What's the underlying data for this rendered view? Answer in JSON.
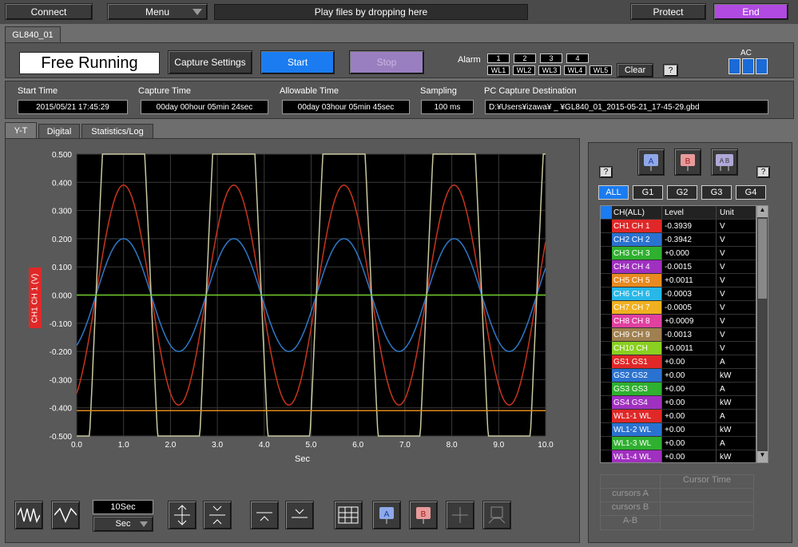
{
  "topbar": {
    "connect": "Connect",
    "menu": "Menu",
    "drop_hint": "Play files by dropping here",
    "protect": "Protect",
    "end": "End"
  },
  "device_tab": "GL840_01",
  "status": {
    "mode": "Free Running",
    "capture_settings": "Capture Settings",
    "start": "Start",
    "stop": "Stop"
  },
  "alarm": {
    "label": "Alarm",
    "numbers": [
      "1",
      "2",
      "3",
      "4"
    ],
    "wl": [
      "WL1",
      "WL2",
      "WL3",
      "WL4",
      "WL5"
    ],
    "clear": "Clear",
    "help": "?",
    "ac": "AC"
  },
  "info": {
    "start_time_label": "Start Time",
    "start_time": "2015/05/21 17:45:29",
    "capture_time_label": "Capture Time",
    "capture_time": "00day 00hour 05min 24sec",
    "allowable_time_label": "Allowable Time",
    "allowable_time": "00day 03hour 05min 45sec",
    "sampling_label": "Sampling",
    "sampling": "100 ms",
    "dest_label": "PC Capture Destination",
    "dest": "D:¥Users¥izawa¥ _ ¥GL840_01_2015-05-21_17-45-29.gbd"
  },
  "view_tabs": [
    "Y-T",
    "Digital",
    "Statistics/Log"
  ],
  "chart_data": {
    "type": "line",
    "ylabel": "CH1 CH 1 (V)",
    "xlabel": "Sec",
    "ylim": [
      -0.5,
      0.5
    ],
    "xlim": [
      0,
      10
    ],
    "yticks": [
      "0.500",
      "0.400",
      "0.300",
      "0.200",
      "0.100",
      "0.000",
      "-0.100",
      "-0.200",
      "-0.300",
      "-0.400",
      "-0.500"
    ],
    "xticks": [
      "0.0",
      "1.0",
      "2.0",
      "3.0",
      "4.0",
      "5.0",
      "6.0",
      "7.0",
      "8.0",
      "9.0",
      "10.0"
    ],
    "series": [
      {
        "color": "#c8341e",
        "amplitude": 0.39,
        "period": 2.35,
        "phase_peak_x": 1.0
      },
      {
        "color": "#2f78c8",
        "amplitude": 0.2,
        "period": 2.35,
        "phase_peak_x": 1.0
      },
      {
        "color": "#c8c8a0",
        "amplitude": 1.4,
        "period": 2.35,
        "phase_peak_x": 1.0
      },
      {
        "color": "#6fcf2e",
        "constant": 0.0
      },
      {
        "color": "#e0891a",
        "constant": -0.41
      }
    ]
  },
  "side": {
    "help": "?",
    "groups": [
      "ALL",
      "G1",
      "G2",
      "G3",
      "G4"
    ],
    "headers": [
      "CH(ALL)",
      "Level",
      "Unit"
    ],
    "rows": [
      {
        "ch": "CH1  CH 1",
        "level": "-0.3939",
        "unit": "V",
        "color": "#e02828"
      },
      {
        "ch": "CH2  CH 2",
        "level": "-0.3942",
        "unit": "V",
        "color": "#2a72d0"
      },
      {
        "ch": "CH3  CH 3",
        "level": "+0.000",
        "unit": "V",
        "color": "#2fb02f"
      },
      {
        "ch": "CH4  CH 4",
        "level": "-0.0015",
        "unit": "V",
        "color": "#a030c0"
      },
      {
        "ch": "CH5  CH 5",
        "level": "+0.0011",
        "unit": "V",
        "color": "#e88a20"
      },
      {
        "ch": "CH6  CH 6",
        "level": "-0.0003",
        "unit": "V",
        "color": "#28b8e8"
      },
      {
        "ch": "CH7  CH 7",
        "level": "-0.0005",
        "unit": "V",
        "color": "#f0b020"
      },
      {
        "ch": "CH8  CH 8",
        "level": "+0.0009",
        "unit": "V",
        "color": "#e040a0"
      },
      {
        "ch": "CH9  CH 9",
        "level": "-0.0013",
        "unit": "V",
        "color": "#a08050"
      },
      {
        "ch": "CH10  CH",
        "level": "+0.0011",
        "unit": "V",
        "color": "#8ad020"
      },
      {
        "ch": "GS1  GS1",
        "level": "+0.00",
        "unit": "A",
        "color": "#e02828"
      },
      {
        "ch": "GS2  GS2",
        "level": "+0.00",
        "unit": "kW",
        "color": "#2a72d0"
      },
      {
        "ch": "GS3  GS3",
        "level": "+0.00",
        "unit": "A",
        "color": "#2fb02f"
      },
      {
        "ch": "GS4  GS4",
        "level": "+0.00",
        "unit": "kW",
        "color": "#a030c0"
      },
      {
        "ch": "WL1-1  WL",
        "level": "+0.00",
        "unit": "A",
        "color": "#e02828"
      },
      {
        "ch": "WL1-2  WL",
        "level": "+0.00",
        "unit": "kW",
        "color": "#2a72d0"
      },
      {
        "ch": "WL1-3  WL",
        "level": "+0.00",
        "unit": "A",
        "color": "#2fb02f"
      },
      {
        "ch": "WL1-4  WL",
        "level": "+0.00",
        "unit": "kW",
        "color": "#a030c0"
      }
    ]
  },
  "cursor": {
    "title": "Cursor Time",
    "a": "cursors A",
    "b": "cursors B",
    "ab": "A-B"
  },
  "bottom": {
    "time_span": "10Sec",
    "unit": "Sec"
  }
}
